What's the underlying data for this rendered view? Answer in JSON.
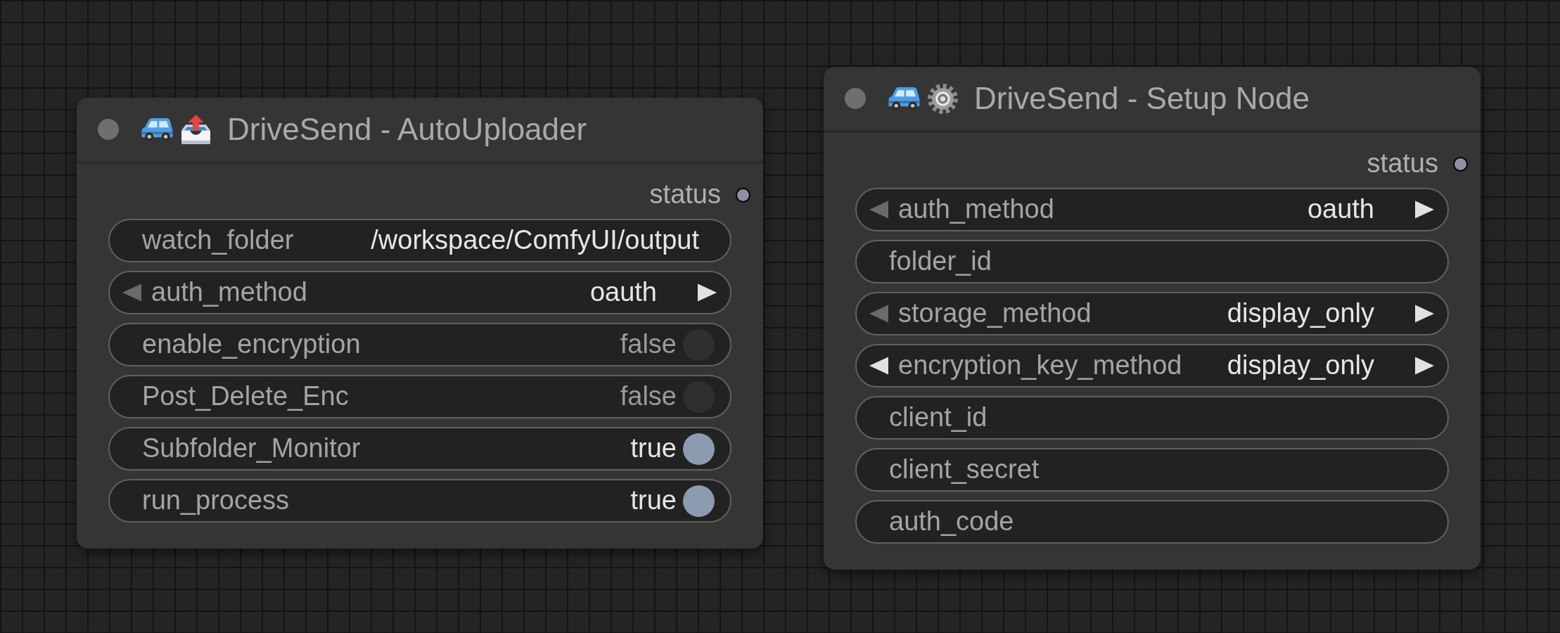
{
  "nodes": [
    {
      "title": "DriveSend - AutoUploader",
      "output": "status",
      "widgets": [
        {
          "kind": "text",
          "label": "watch_folder",
          "value": "/workspace/ComfyUI/output"
        },
        {
          "kind": "combo",
          "label": "auth_method",
          "value": "oauth",
          "prev_enabled": false,
          "next_enabled": true
        },
        {
          "kind": "toggle",
          "label": "enable_encryption",
          "value": "false",
          "checked": false
        },
        {
          "kind": "toggle",
          "label": "Post_Delete_Enc",
          "value": "false",
          "checked": false
        },
        {
          "kind": "toggle",
          "label": "Subfolder_Monitor",
          "value": "true",
          "checked": true
        },
        {
          "kind": "toggle",
          "label": "run_process",
          "value": "true",
          "checked": true
        }
      ]
    },
    {
      "title": "DriveSend - Setup Node",
      "output": "status",
      "widgets": [
        {
          "kind": "combo",
          "label": "auth_method",
          "value": "oauth",
          "prev_enabled": false,
          "next_enabled": true
        },
        {
          "kind": "text",
          "label": "folder_id"
        },
        {
          "kind": "combo",
          "label": "storage_method",
          "value": "display_only",
          "prev_enabled": false,
          "next_enabled": true
        },
        {
          "kind": "combo",
          "label": "encryption_key_method",
          "value": "display_only",
          "prev_enabled": true,
          "next_enabled": true
        },
        {
          "kind": "text",
          "label": "client_id"
        },
        {
          "kind": "text",
          "label": "client_secret"
        },
        {
          "kind": "text",
          "label": "auth_code"
        }
      ]
    }
  ]
}
